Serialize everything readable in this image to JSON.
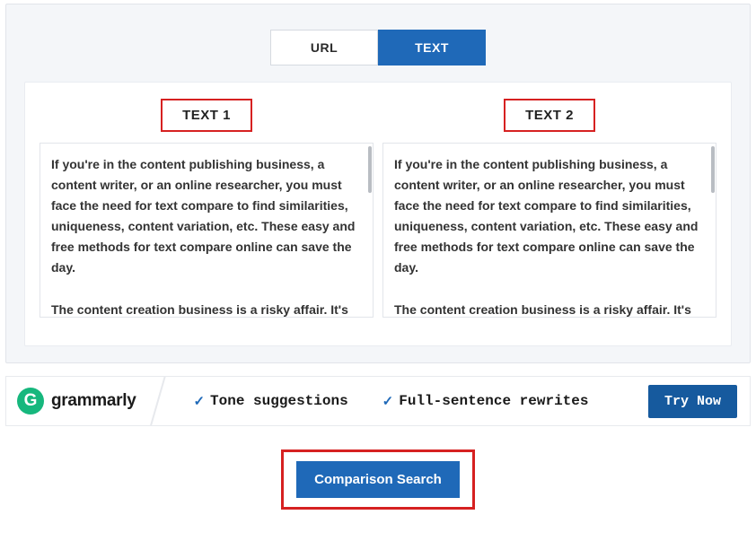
{
  "tabs": {
    "url": "URL",
    "text": "TEXT"
  },
  "columns": {
    "left": {
      "label": "TEXT 1",
      "content": "If you're in the content publishing business, a content writer, or an online researcher, you must face the need for text compare to find similarities, uniqueness, content variation, etc. These easy and free methods for text compare online can save the day.\n\nThe content creation business is a risky affair. It's"
    },
    "right": {
      "label": "TEXT 2",
      "content": "If you're in the content publishing business, a content writer, or an online researcher, you must face the need for text compare to find similarities, uniqueness, content variation, etc. These easy and free methods for text compare online can save the day.\n\nThe content creation business is a risky affair. It's"
    }
  },
  "ad": {
    "logo_letter": "G",
    "brand": "grammarly",
    "feature1": "Tone suggestions",
    "feature2": "Full-sentence rewrites",
    "cta": "Try Now"
  },
  "action": {
    "compare": "Comparison Search"
  }
}
